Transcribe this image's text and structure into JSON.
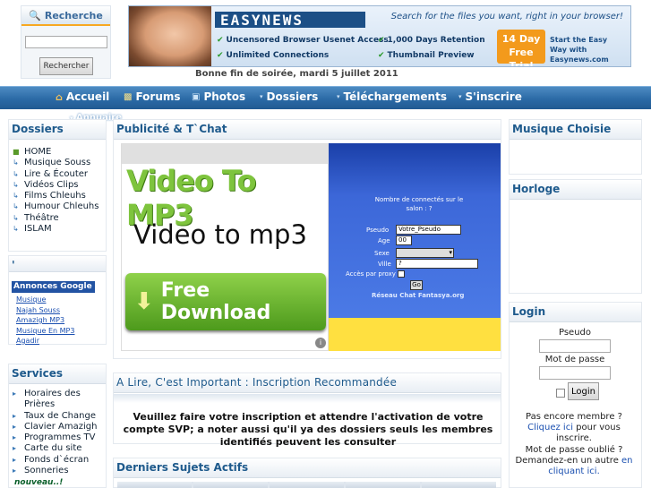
{
  "search": {
    "title": "Recherche",
    "button": "Rechercher",
    "input_value": ""
  },
  "banner": {
    "logo": "EASYNEWS",
    "tagline": "Search for the files you want, right in your browser!",
    "features": [
      "Uncensored Browser Usenet Access",
      "1,000 Days Retention",
      "Unlimited Connections",
      "Thumbnail Preview"
    ],
    "trial": "14 Day Free Trial",
    "cta": "Start the Easy Way with Easynews.com"
  },
  "greeting": "Bonne fin de soirée, mardi 5 juillet 2011",
  "nav": {
    "items": [
      "Accueil",
      "Forums",
      "Photos",
      "Dossiers",
      "Téléchargements",
      "S'inscrire"
    ],
    "sub": "Annuaire"
  },
  "left": {
    "dossiers_title": "Dossiers",
    "dossiers": [
      "HOME",
      "Musique Souss",
      "Lire & Écouter",
      "Vidéos Clips",
      "Films Chleuhs",
      "Humour Chleuhs",
      "Théâtre",
      "ISLAM"
    ],
    "dot": "'",
    "ads_title": "Annonces Google",
    "ads": [
      "Musique",
      "Najah Souss",
      "Amazigh MP3",
      "Musique En MP3",
      "Agadir"
    ],
    "services_title": "Services",
    "services": [
      "Horaires des Prières",
      "Taux de Change",
      "Clavier Amazigh",
      "Programmes TV",
      "Carte du site",
      "Fonds d`écran",
      "Sonneries"
    ],
    "new_label": "nouveau..!"
  },
  "center": {
    "pub_title": "Publicité & T`Chat",
    "video_title": "Video To MP3",
    "video_sub": "Video to mp3",
    "video_button": "Free Download",
    "chat": {
      "connected": "Nombre de connectés sur le salon : ?",
      "pseudo_label": "Pseudo",
      "pseudo_value": "Votre_Pseudo",
      "age_label": "Age",
      "age_value": "00",
      "sexe_label": "Sexe",
      "ville_label": "Ville",
      "ville_value": "?",
      "proxy_label": "Accès par proxy",
      "go": "Go",
      "footer": "Réseau Chat Fantasya.org"
    },
    "info_title": "A Lire, C'est Important : Inscription Recommandée",
    "info_msg": "Veuillez faire votre inscription et attendre l'activation de votre compte SVP; a noter aussi qu'il ya des dossiers seuls les membres identifiés peuvent les consulter",
    "recent_title": "Derniers Sujets Actifs"
  },
  "right": {
    "music_title": "Musique Choisie",
    "clock_title": "Horloge",
    "login_title": "Login",
    "pseudo_label": "Pseudo",
    "password_label": "Mot de passe",
    "login_button": "Login",
    "not_member": "Pas encore membre ?",
    "signup_link": "Cliquez ici",
    "signup_suffix": "pour vous inscrire.",
    "forgot": "Mot de passe oublié ?",
    "forgot_prefix": "Demandez-en un autre",
    "forgot_link": "en cliquant ici."
  }
}
